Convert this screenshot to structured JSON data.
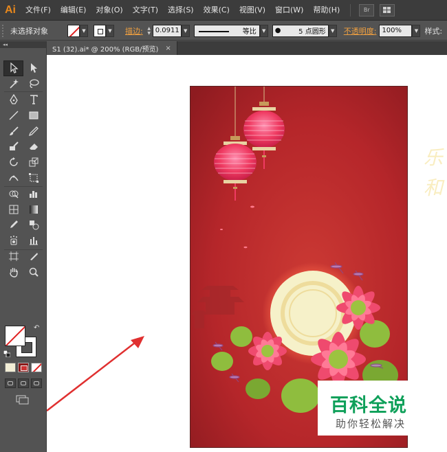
{
  "app": {
    "logo": "Ai"
  },
  "menu": {
    "items": [
      "文件(F)",
      "编辑(E)",
      "对象(O)",
      "文字(T)",
      "选择(S)",
      "效果(C)",
      "视图(V)",
      "窗口(W)",
      "帮助(H)"
    ],
    "bridge_label": "Br"
  },
  "control": {
    "selection_status": "未选择对象",
    "stroke_label": "描边:",
    "stroke_weight": "0.0911",
    "stroke_profile": "等比",
    "brush": "5 点圆形",
    "opacity_label": "不透明度:",
    "opacity_value": "100%",
    "style_label": "样式:"
  },
  "document": {
    "tab_title": "S1 (32).ai* @ 200% (RGB/预览)",
    "close_glyph": "×"
  },
  "watermark": {
    "title": "百科全说",
    "subtitle": "助你轻松解决"
  },
  "canvas": {
    "side_text": "乐 和"
  },
  "colors": {
    "poster_red": "#b5262a",
    "lantern_pink": "#ef3b62",
    "moon": "#f6f1c9",
    "leaf": "#8fbd3e",
    "arrow": "#e03030",
    "watermark_green": "#0fa05a"
  }
}
